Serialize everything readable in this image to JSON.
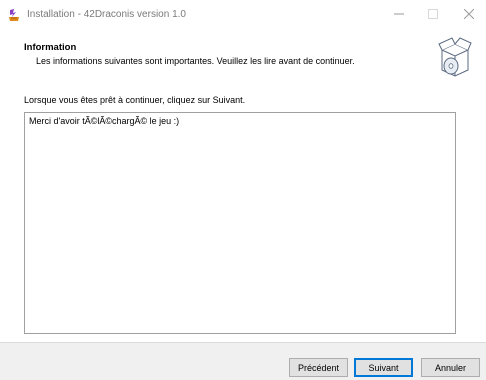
{
  "window": {
    "title": "Installation - 42Draconis version 1.0",
    "icon": "setup-app-icon"
  },
  "window_controls": {
    "minimize_icon": "minimize-icon",
    "maximize_icon": "maximize-icon",
    "close_icon": "close-icon"
  },
  "header": {
    "title": "Information",
    "subtitle": "Les informations suivantes sont importantes. Veuillez les lire avant de continuer.",
    "icon": "install-box-disc-icon"
  },
  "body": {
    "instruction": "Lorsque vous êtes prêt à continuer, cliquez sur Suivant.",
    "info_text": "Merci d'avoir tÃ©lÃ©chargÃ© le jeu :)"
  },
  "buttons": {
    "back_label": "Précédent",
    "next_label": "Suivant",
    "cancel_label": "Annuler"
  },
  "colors": {
    "focus_border": "#0078d7",
    "panel_background": "#f0f0f0",
    "title_text": "#7a7a7a"
  }
}
